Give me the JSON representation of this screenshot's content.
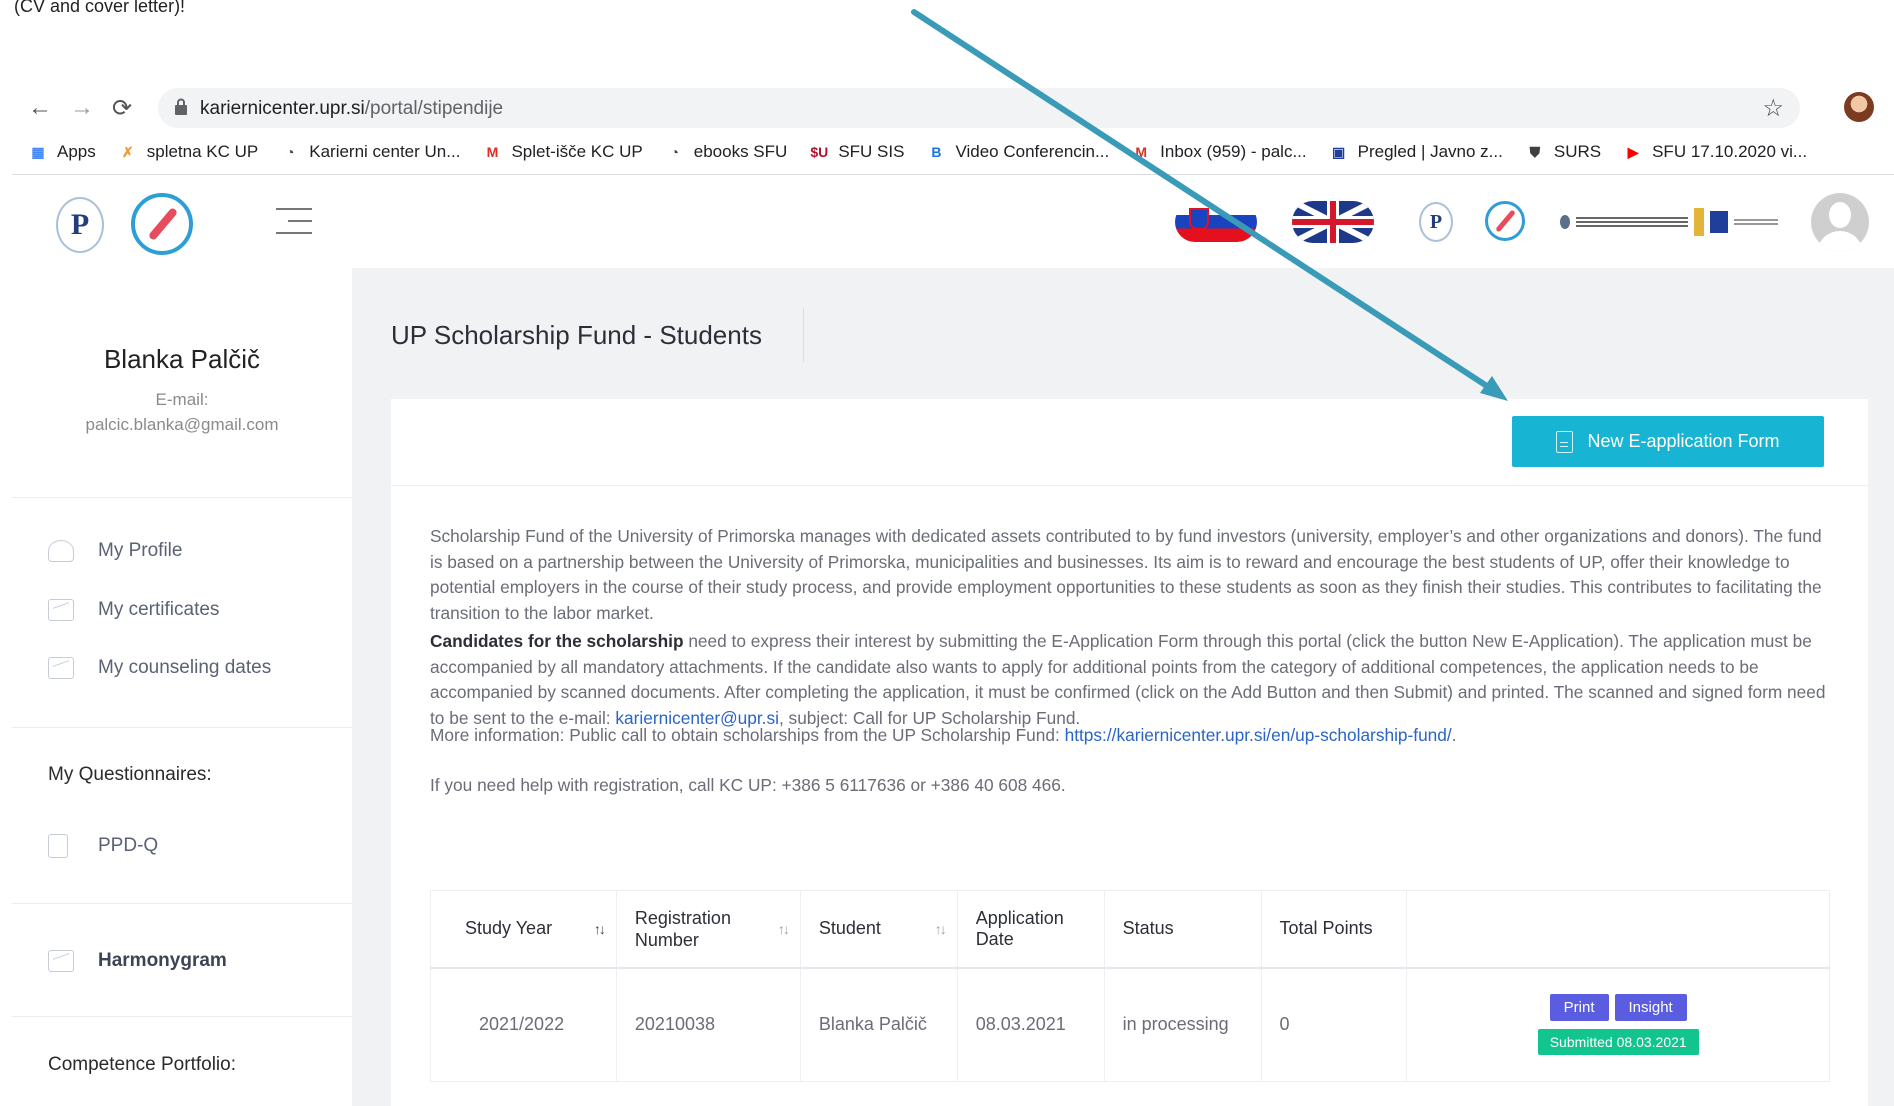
{
  "caption": "(CV and cover letter)!",
  "browser": {
    "url_host": "kariernicenter.upr.si",
    "url_path": "/portal/stipendije",
    "bookmarks": [
      {
        "label": "Apps",
        "icon": "apps-grid-icon",
        "color": "#4285f4"
      },
      {
        "label": "spletna KC UP",
        "icon": "kc-logo-icon",
        "color": "#f29a38"
      },
      {
        "label": "Karierni center Un...",
        "icon": "globe-icon",
        "color": "#444444"
      },
      {
        "label": "Splet-išče KC UP",
        "icon": "m-logo-icon",
        "color": "#d93025"
      },
      {
        "label": "ebooks SFU",
        "icon": "globe-icon",
        "color": "#444444"
      },
      {
        "label": "SFU SIS",
        "icon": "sfu-logo-icon",
        "color": "#b5122b"
      },
      {
        "label": "Video Conferencin...",
        "icon": "bb-logo-icon",
        "color": "#1a73e8"
      },
      {
        "label": "Inbox (959) - palc...",
        "icon": "gmail-icon",
        "color": "#d93025"
      },
      {
        "label": "Pregled | Javno z...",
        "icon": "eu-flag-icon",
        "color": "#1f3f9a"
      },
      {
        "label": "SURS",
        "icon": "shield-icon",
        "color": "#3c4043"
      },
      {
        "label": "SFU 17.10.2020 vi...",
        "icon": "youtube-icon",
        "color": "#ff0000"
      }
    ]
  },
  "user": {
    "name": "Blanka Palčič",
    "email_label": "E-mail:",
    "email": "palcic.blanka@gmail.com"
  },
  "sidebar": {
    "items": [
      {
        "label": "My Profile",
        "icon": "profile-icon"
      },
      {
        "label": "My certificates",
        "icon": "chart-icon"
      },
      {
        "label": "My counseling dates",
        "icon": "chart-icon"
      }
    ],
    "questionnaires_heading": "My Questionnaires:",
    "questionnaire_item": "PPD-Q",
    "harmonygram": "Harmonygram",
    "portfolio_heading": "Competence Portfolio:"
  },
  "main": {
    "title": "UP Scholarship Fund - Students",
    "new_button": "New E-application Form",
    "intro": "Scholarship Fund of the University of Primorska manages with dedicated assets contributed to by fund investors (university, employer’s and other organizations and donors). The fund is based on a partnership between the University of Primorska, municipalities and businesses. Its aim is to reward and encourage the best students of UP, offer their knowledge to potential employers in the course of their study process, and provide employment opportunities to these students as soon as they finish their studies. This contributes to facilitating the transition to the labor market.",
    "candidates_bold": "Candidates for the scholarship",
    "candidates_text": " need to express their interest by submitting the E-Application Form through this portal (click the button New E-Application). The application must be accompanied by all mandatory attachments. If the candidate also wants to apply for additional points from the category of additional competences, the application needs to be accompanied by scanned documents. After completing the application, it must be confirmed (click on the Add Button and then Submit) and printed. The scanned and signed form need to be sent to the e-mail: ",
    "candidates_email": "kariernicenter@upr.si",
    "candidates_tail": ", subject: Call for UP Scholarship Fund.",
    "more_info_text": "More information: Public call to obtain scholarships from the UP Scholarship Fund: ",
    "more_info_link": "https://kariernicenter.upr.si/en/up-scholarship-fund/",
    "more_info_tail": ".",
    "help_text": "If you need help with registration, call KC UP: +386 5 6117636 or +386 40 608 466."
  },
  "table": {
    "headers": [
      "Study Year",
      "Registration Number",
      "Student",
      "Application Date",
      "Status",
      "Total Points",
      ""
    ],
    "row": {
      "study_year": "2021/2022",
      "registration_number": "20210038",
      "student": "Blanka Palčič",
      "application_date": "08.03.2021",
      "status": "in processing",
      "total_points": "0",
      "print": "Print",
      "insight": "Insight",
      "submitted": "Submitted 08.03.2021"
    }
  },
  "colors": {
    "accent": "#17b5d3",
    "action_button": "#5b5de0",
    "submitted_badge": "#12c58f",
    "annotation_arrow": "#3a9bb8"
  }
}
